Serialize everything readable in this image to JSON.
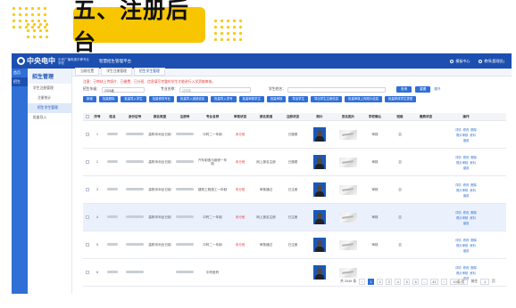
{
  "banner": {
    "title": "五、注册后台"
  },
  "topbar": {
    "logo_text": "中央电中",
    "logo_sub": "中央广播电视中等专业学校",
    "system_name": "智慧招生管理平台",
    "right_items": [
      "模板中心",
      "教师(管理员)"
    ]
  },
  "strip": {
    "items": [
      "首页",
      "招生"
    ]
  },
  "sidebar": {
    "header": "招生管理",
    "items": [
      {
        "label": "学生注册管理",
        "level": 1,
        "active": false
      },
      {
        "label": "注册统计",
        "level": 2,
        "active": false
      },
      {
        "label": "招生学生管理",
        "level": 2,
        "active": true
      },
      {
        "label": "批量导入",
        "level": 1,
        "active": false
      }
    ]
  },
  "tabs": [
    "当前位置",
    "学生注册管理",
    "招生学生管理"
  ],
  "notice": "注意：已审核上传照片、已缴费、已分班、信息填写完整的学生才能进行入学资格审核。",
  "filters": {
    "year_label": "招生年级：",
    "year_value": "2024级",
    "major_label": "专业名称：",
    "major_placeholder": "请选择",
    "name_label": "学生姓名：",
    "search_button": "查询",
    "reset_button": "重置",
    "expand_link": "展开"
  },
  "actions": [
    "新增",
    "批量删除",
    "批量导入学生",
    "批量修改专业",
    "批量导入缴费信息",
    "批量导入学号",
    "批量审核学生",
    "批量审核",
    "导出学生",
    "导出学生注册信息",
    "批量审核上传照片信息",
    "批量修改学生类型"
  ],
  "table": {
    "headers": [
      "",
      "序号",
      "姓名",
      "身份证号",
      "报名类型",
      "注册号",
      "专业名称",
      "审核状态",
      "报名渠道",
      "注册状态",
      "照片",
      "签名图片",
      "学校确认",
      "班级",
      "缴费状态",
      "操作"
    ],
    "rows": [
      {
        "idx": "1",
        "type": "高职本科全日制",
        "major": "中药二一年制",
        "status": "未分班",
        "channel": "",
        "reg": "已缴费",
        "school": "审核",
        "cls": "否",
        "pay": "",
        "highlight": false
      },
      {
        "idx": "2",
        "type": "高职本科全日制",
        "major": "汽车制造与维修一年制",
        "status": "未分班",
        "channel": "网上报名注册",
        "reg": "已缴费",
        "school": "审核",
        "cls": "否",
        "pay": "",
        "highlight": false
      },
      {
        "idx": "3",
        "type": "高职本科全日制",
        "major": "建筑工程施工一年制",
        "status": "未分班",
        "channel": "审核通过",
        "reg": "已注册",
        "school": "审核",
        "cls": "否",
        "pay": "",
        "highlight": false
      },
      {
        "idx": "4",
        "type": "高职本科全日制",
        "major": "中药二一年制",
        "status": "未分班",
        "channel": "网上报名注册",
        "reg": "已注册",
        "school": "审核",
        "cls": "否",
        "pay": "",
        "highlight": true
      },
      {
        "idx": "5",
        "type": "高职本科全日制",
        "major": "中药二一年制",
        "status": "未分班",
        "channel": "审核通过",
        "reg": "已注册",
        "school": "审核",
        "cls": "否",
        "pay": "",
        "highlight": false
      },
      {
        "idx": "6",
        "type": "",
        "major": "中药医药",
        "status": "",
        "channel": "",
        "reg": "",
        "school": "",
        "cls": "",
        "pay": "",
        "highlight": false
      }
    ],
    "op_links": [
      "详情",
      "修改",
      "删除",
      "照片审核",
      "资料",
      "缴费"
    ]
  },
  "pager": {
    "total": "共 2049 条",
    "pages": [
      "1",
      "2",
      "3",
      "4",
      "5",
      "6",
      "...",
      "41"
    ],
    "active_page": "1",
    "page_size": "10条/页",
    "goto_label": "前往",
    "goto_value": "1",
    "page_unit": "页"
  }
}
